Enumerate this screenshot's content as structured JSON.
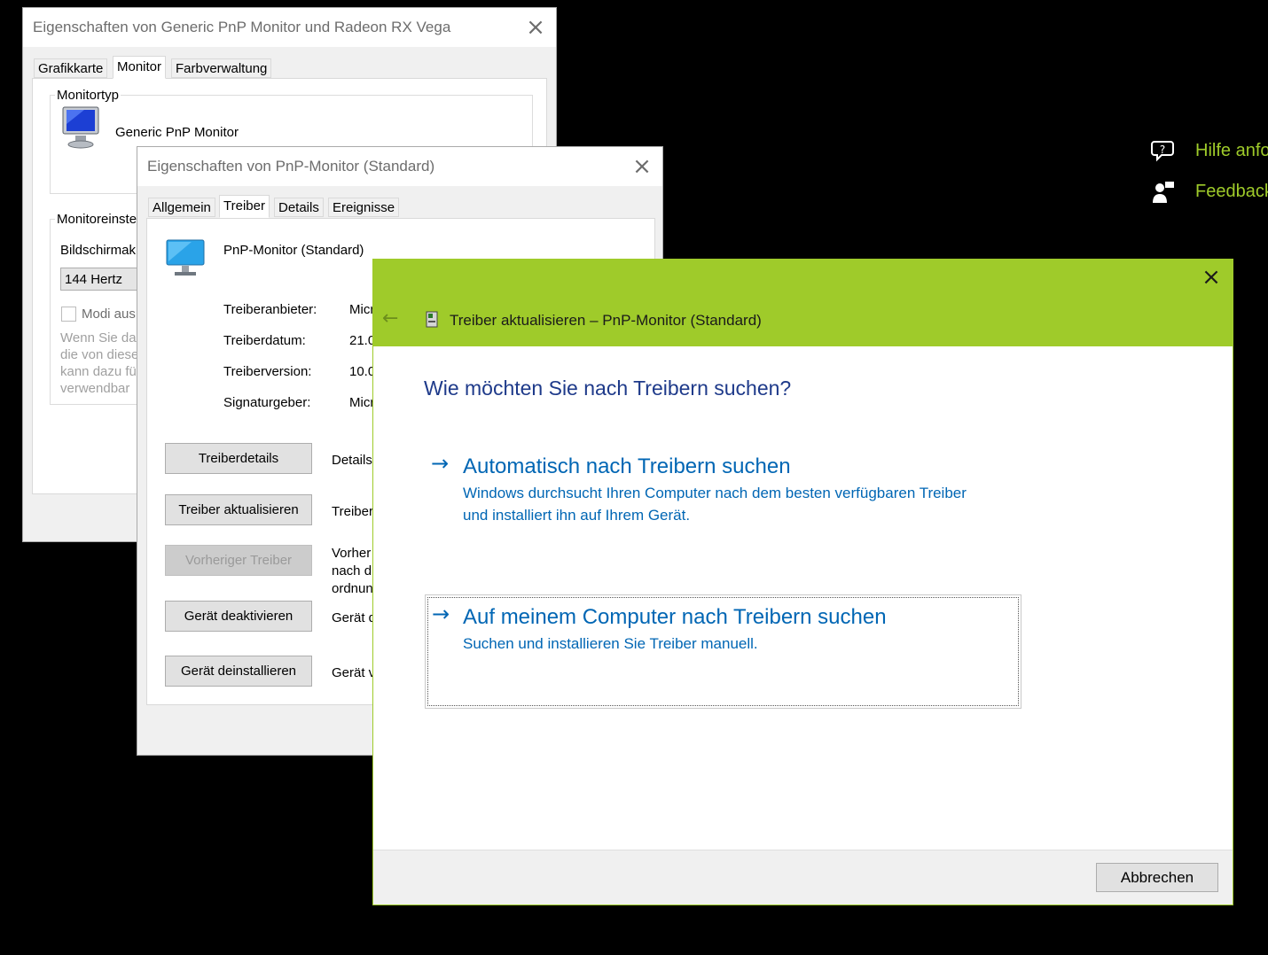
{
  "background": {
    "help_label": "Hilfe anfo",
    "feedback_label": "Feedback",
    "accent_color": "#9fcb2a"
  },
  "win1": {
    "title": "Eigenschaften von Generic PnP Monitor und Radeon RX Vega",
    "tabs": [
      "Grafikkarte",
      "Monitor",
      "Farbverwaltung"
    ],
    "monitortyp_label": "Monitortyp",
    "monitor_name": "Generic PnP Monitor",
    "monitoreinst_label": "Monitoreinste",
    "bildschirm_label": "Bildschirmak",
    "refresh_value": "144 Hertz",
    "modi_label": "Modi aus",
    "hint_lines": [
      "Wenn Sie da",
      "die von diese",
      "kann dazu fü",
      "verwendbar"
    ]
  },
  "win2": {
    "title": "Eigenschaften von PnP-Monitor (Standard)",
    "tabs": [
      "Allgemein",
      "Treiber",
      "Details",
      "Ereignisse"
    ],
    "device_name": "PnP-Monitor (Standard)",
    "info": [
      {
        "label": "Treiberanbieter:",
        "value": "Micr"
      },
      {
        "label": "Treiberdatum:",
        "value": "21.0"
      },
      {
        "label": "Treiberversion:",
        "value": "10.0"
      },
      {
        "label": "Signaturgeber:",
        "value": "Micr"
      }
    ],
    "buttons": [
      {
        "label": "Treiberdetails",
        "desc": "Details"
      },
      {
        "label": "Treiber aktualisieren",
        "desc": "Treiber"
      },
      {
        "label": "Vorheriger Treiber",
        "desc_lines": [
          "Vorher",
          "nach d",
          "ordnun"
        ]
      },
      {
        "label": "Gerät deaktivieren",
        "desc": "Gerät d"
      },
      {
        "label": "Gerät deinstallieren",
        "desc": "Gerät v"
      }
    ]
  },
  "wizard": {
    "title": "Treiber aktualisieren – PnP-Monitor (Standard)",
    "question": "Wie möchten Sie nach Treibern suchen?",
    "option1": {
      "title": "Automatisch nach Treibern suchen",
      "desc1": "Windows durchsucht Ihren Computer nach dem besten verfügbaren Treiber",
      "desc2": "und installiert ihn auf Ihrem Gerät."
    },
    "option2": {
      "title": "Auf meinem Computer nach Treibern suchen",
      "desc": "Suchen und installieren Sie Treiber manuell."
    },
    "cancel_label": "Abbrechen"
  }
}
